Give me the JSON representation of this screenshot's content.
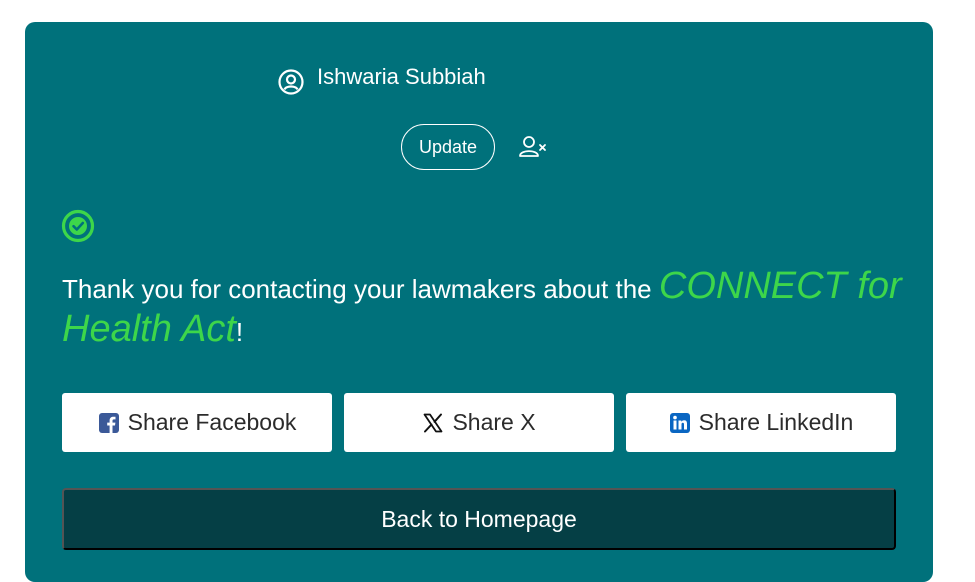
{
  "user": {
    "name": "Ishwaria Subbiah",
    "update_label": "Update"
  },
  "message": {
    "prefix": "Thank you for contacting your lawmakers about the ",
    "campaign": "CONNECT for Health Act",
    "suffix": "!"
  },
  "share": {
    "facebook_label": "Share Facebook",
    "x_label": "Share X",
    "linkedin_label": "Share LinkedIn"
  },
  "back_label": "Back to Homepage",
  "icons": {
    "user": "user-circle-icon",
    "remove_user": "user-remove-icon",
    "success": "check-circle-icon",
    "facebook": "facebook-icon",
    "x": "x-icon",
    "linkedin": "linkedin-icon"
  },
  "colors": {
    "card_background": "#00717b",
    "accent_green": "#3dd64a",
    "back_button": "#053f45",
    "facebook_blue": "#3b5998",
    "linkedin_blue": "#0a66c2"
  }
}
